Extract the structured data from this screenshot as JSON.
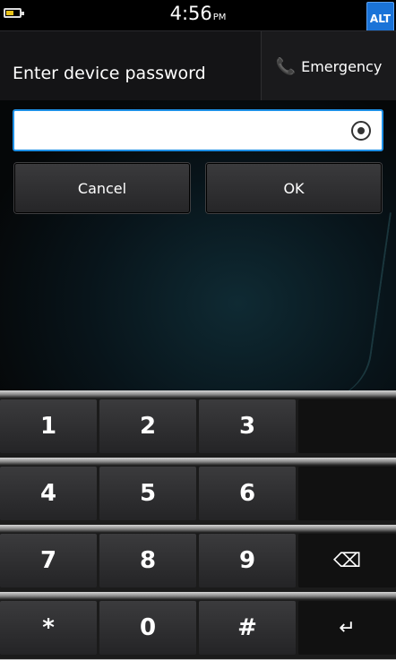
{
  "status": {
    "time": "4:56",
    "ampm": "PM",
    "battery_level": 0.55,
    "alt_label": "ALT"
  },
  "header": {
    "title": "Enter device password",
    "emergency_label": "Emergency",
    "emergency_icon": "phone-icon"
  },
  "password": {
    "value": "",
    "toggle_icon": "eye-icon"
  },
  "buttons": {
    "cancel": "Cancel",
    "ok": "OK"
  },
  "keypad": {
    "rows": [
      [
        "1",
        "2",
        "3",
        ""
      ],
      [
        "4",
        "5",
        "6",
        ""
      ],
      [
        "7",
        "8",
        "9",
        "⌫"
      ],
      [
        "*",
        "0",
        "#",
        "↵"
      ]
    ]
  },
  "colors": {
    "accent": "#1e90e6",
    "emergency_icon": "#e01818",
    "alt_key": "#1a73d8"
  }
}
